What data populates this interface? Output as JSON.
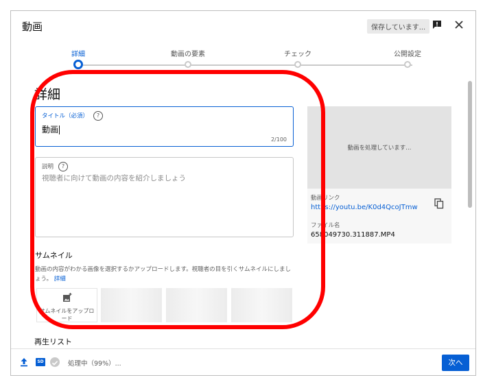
{
  "header": {
    "title": "動画",
    "saving_badge": "保存しています..."
  },
  "steps": [
    {
      "label": "詳細"
    },
    {
      "label": "動画の要素"
    },
    {
      "label": "チェック"
    },
    {
      "label": "公開設定"
    }
  ],
  "details": {
    "heading": "詳細",
    "title_field": {
      "label": "タイトル（必須）",
      "value": "動画",
      "counter": "2/100"
    },
    "description_field": {
      "label": "説明",
      "placeholder": "視聴者に向けて動画の内容を紹介しましょう"
    },
    "thumbnail": {
      "heading": "サムネイル",
      "description": "動画の内容がわかる画像を選択するかアップロードします。視聴者の目を引くサムネイルにしましょう。",
      "more_link": "詳細",
      "upload_label": "サムネイルをアップロード"
    },
    "playlist_heading": "再生リスト"
  },
  "preview": {
    "processing_text": "動画を処理しています...",
    "link_label": "動画リンク",
    "link_url": "https://youtu.be/K0d4QcoJTmw",
    "filename_label": "ファイル名",
    "filename": "658049730.311887.MP4"
  },
  "footer": {
    "sd_badge": "SD",
    "status": "処理中（99%）...",
    "next_label": "次へ"
  },
  "colors": {
    "accent": "#065fd4",
    "annotation": "#ff0000"
  },
  "icons": [
    "feedback-icon",
    "close-icon",
    "help-icon",
    "add-photo-icon",
    "copy-icon",
    "upload-icon",
    "sd-icon",
    "check-icon"
  ]
}
